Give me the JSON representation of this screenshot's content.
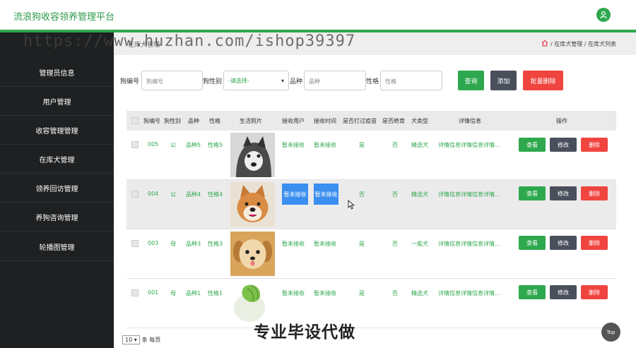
{
  "app": {
    "title": "流浪狗收容领养管理平台"
  },
  "watermark": "https://www.huzhan.com/ishop39397",
  "sidebar": {
    "items": [
      {
        "label": "管理员信息"
      },
      {
        "label": "用户管理"
      },
      {
        "label": "收容管理管理"
      },
      {
        "label": "在库犬管理"
      },
      {
        "label": "领养回访管理"
      },
      {
        "label": "养狗咨询管理"
      },
      {
        "label": "轮播图管理"
      }
    ]
  },
  "breadcrumb": {
    "left": "在库犬管理",
    "home_icon": "home-icon",
    "path": "/ 在库犬管理 / 在库犬列表"
  },
  "search": {
    "dog_no_label": "狗编号",
    "dog_no_placeholder": "狗编号",
    "gender_label": "狗性别",
    "gender_value": "-请选择-",
    "breed_label": "品种",
    "breed_placeholder": "品种",
    "temper_label": "性格",
    "temper_placeholder": "性格",
    "query": "查询",
    "add": "添加",
    "batch_delete": "批量删除"
  },
  "table": {
    "headers": [
      "狗编号",
      "狗性别",
      "品种",
      "性格",
      "生活照片",
      "接收用户",
      "接收时间",
      "是否打过疫苗",
      "是否绝育",
      "犬类型",
      "详情信息",
      "操作"
    ],
    "rows": [
      {
        "no": "005",
        "gender": "公",
        "breed": "品种5",
        "temper": "性格5",
        "photo": "husky",
        "user": "暂未接收",
        "time": "暂未接收",
        "vaccine": "是",
        "neutered": "否",
        "type": "精选犬",
        "detail": "详情信息详情信息详情..."
      },
      {
        "no": "004",
        "gender": "公",
        "breed": "品种4",
        "temper": "性格4",
        "photo": "shiba",
        "user": "暂未接收",
        "time": "暂未接收",
        "vaccine": "否",
        "neutered": "否",
        "type": "精选犬",
        "detail": "详情信息详情信息详情..."
      },
      {
        "no": "003",
        "gender": "母",
        "breed": "品种3",
        "temper": "性格3",
        "photo": "puppy",
        "user": "暂未接收",
        "time": "暂未接收",
        "vaccine": "是",
        "neutered": "否",
        "type": "一般犬",
        "detail": "详情信息详情信息详情..."
      },
      {
        "no": "001",
        "gender": "母",
        "breed": "品种1",
        "temper": "性格1",
        "photo": "cabbage",
        "user": "暂未接收",
        "time": "暂未接收",
        "vaccine": "是",
        "neutered": "否",
        "type": "精选犬",
        "detail": "详情信息详情信息详情..."
      }
    ],
    "actions": {
      "view": "查看",
      "edit": "修改",
      "delete": "删除"
    }
  },
  "pager": {
    "size": "10",
    "per_page": "条 每页"
  },
  "caption": "专业毕设代做",
  "top_button": "Top",
  "colors": {
    "brand_green": "#2ea84e",
    "sidebar": "#1e2022",
    "delete_red": "#f0443f",
    "edit_dark": "#4a4f5c",
    "selected_blue": "#3a8ff0"
  }
}
